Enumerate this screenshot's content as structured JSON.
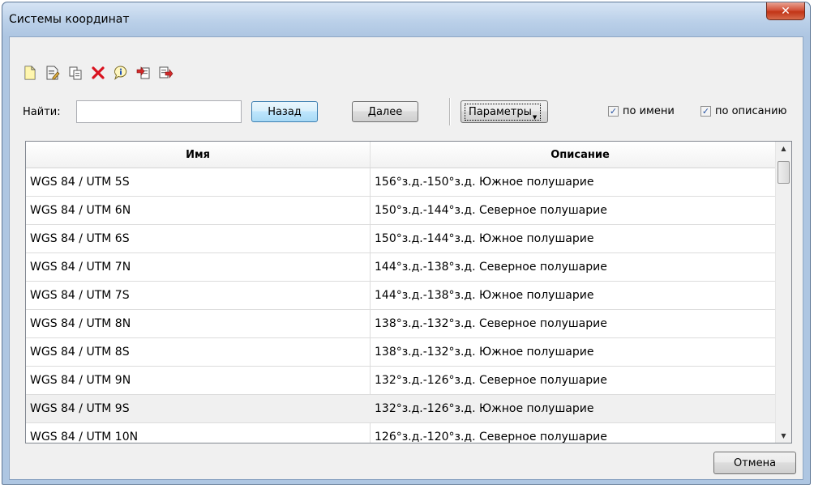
{
  "window": {
    "title": "Системы координат",
    "close_glyph": "✕"
  },
  "toolbar": {
    "icons": [
      "new-icon",
      "edit-icon",
      "copy-icon",
      "delete-icon",
      "info-icon",
      "import-icon",
      "export-icon"
    ]
  },
  "search": {
    "label": "Найти:",
    "value": "",
    "back_label": "Назад",
    "next_label": "Далее",
    "params_label": "Параметры",
    "by_name_label": "по имени",
    "by_name_checked": true,
    "by_desc_label": "по описанию",
    "by_desc_checked": true
  },
  "table": {
    "columns": [
      "Имя",
      "Описание"
    ],
    "rows": [
      {
        "name": "WGS 84 / UTM  5S",
        "desc": "156°з.д.-150°з.д. Южное полушарие"
      },
      {
        "name": "WGS 84 / UTM  6N",
        "desc": "150°з.д.-144°з.д. Северное полушарие"
      },
      {
        "name": "WGS 84 / UTM  6S",
        "desc": "150°з.д.-144°з.д. Южное полушарие"
      },
      {
        "name": "WGS 84 / UTM  7N",
        "desc": "144°з.д.-138°з.д. Северное полушарие"
      },
      {
        "name": "WGS 84 / UTM  7S",
        "desc": "144°з.д.-138°з.д. Южное полушарие"
      },
      {
        "name": "WGS 84 / UTM  8N",
        "desc": "138°з.д.-132°з.д. Северное полушарие"
      },
      {
        "name": "WGS 84 / UTM  8S",
        "desc": "138°з.д.-132°з.д. Южное полушарие"
      },
      {
        "name": "WGS 84 / UTM  9N",
        "desc": "132°з.д.-126°з.д. Северное полушарие"
      },
      {
        "name": "WGS 84 / UTM  9S",
        "desc": "132°з.д.-126°з.д. Южное полушарие"
      },
      {
        "name": "WGS 84 / UTM 10N",
        "desc": "126°з.д.-120°з.д. Северное полушарие"
      }
    ],
    "selected_index": 8
  },
  "footer": {
    "cancel_label": "Отмена"
  },
  "colors": {
    "title_bar": "#aec6e2",
    "close_button": "#c23416",
    "selected_row": "#f0f0f0"
  }
}
